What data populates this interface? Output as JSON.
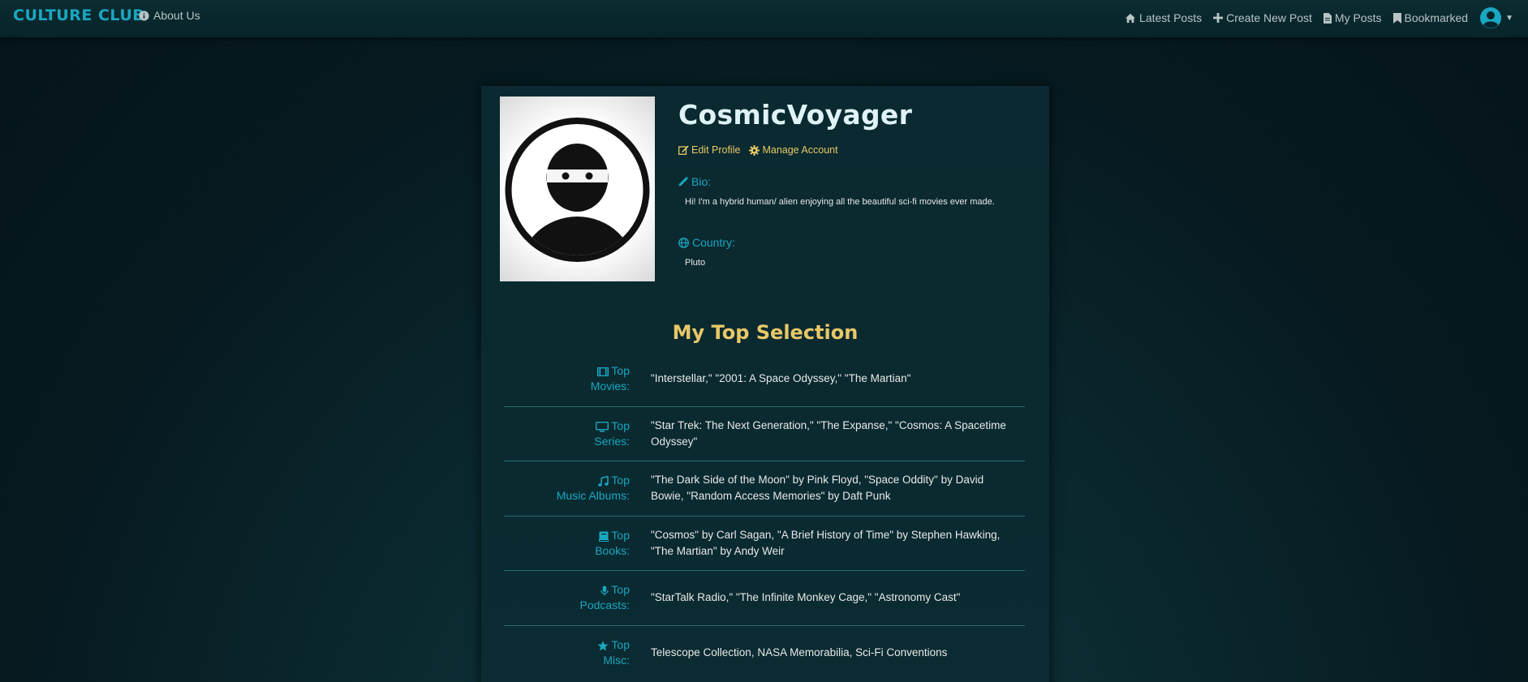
{
  "nav": {
    "brand": "CULTURE CLUB",
    "about": "About Us",
    "links": [
      "Latest Posts",
      "Create New Post",
      "My Posts",
      "Bookmarked"
    ]
  },
  "profile": {
    "username": "CosmicVoyager",
    "edit_label": "Edit Profile",
    "manage_label": "Manage Account",
    "bio_label": "Bio:",
    "bio": "Hi! I'm a hybrid human/ alien enjoying all the beautiful sci-fi movies ever made.",
    "country_label": "Country:",
    "country": "Pluto"
  },
  "top_selection": {
    "title": "My Top Selection",
    "rows": [
      {
        "icon": "film-icon",
        "label_a": "Top",
        "label_b": "Movies:",
        "value": "\"Interstellar,\" \"2001: A Space Odyssey,\" \"The Martian\""
      },
      {
        "icon": "tv-icon",
        "label_a": "Top",
        "label_b": "Series:",
        "value": "\"Star Trek: The Next Generation,\" \"The Expanse,\" \"Cosmos: A Spacetime Odyssey\""
      },
      {
        "icon": "music-icon",
        "label_a": "Top",
        "label_b": "Music Albums:",
        "value": "\"The Dark Side of the Moon\" by Pink Floyd, \"Space Oddity\" by David Bowie, \"Random Access Memories\" by Daft Punk"
      },
      {
        "icon": "book-icon",
        "label_a": "Top",
        "label_b": "Books:",
        "value": "\"Cosmos\" by Carl Sagan, \"A Brief History of Time\" by Stephen Hawking, \"The Martian\" by Andy Weir"
      },
      {
        "icon": "microphone-icon",
        "label_a": "Top",
        "label_b": "Podcasts:",
        "value": "\"StarTalk Radio,\" \"The Infinite Monkey Cage,\" \"Astronomy Cast\""
      },
      {
        "icon": "star-icon",
        "label_a": "Top",
        "label_b": "Misc:",
        "value": "Telescope Collection, NASA Memorabilia, Sci-Fi Conventions"
      }
    ]
  },
  "colors": {
    "accent": "#1aa7c1",
    "highlight": "#e8c867",
    "background": "#061a20"
  }
}
